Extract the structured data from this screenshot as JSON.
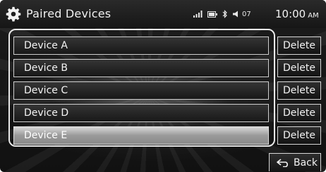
{
  "header": {
    "title": "Paired Devices",
    "volume_level": "07",
    "time": "10:00",
    "ampm": "AM",
    "icons": [
      "settings-gear-icon",
      "signal-strength-icon",
      "battery-icon",
      "bluetooth-icon",
      "speaker-volume-icon"
    ]
  },
  "devices": [
    {
      "label": "Device A",
      "selected": false
    },
    {
      "label": "Device B",
      "selected": false
    },
    {
      "label": "Device C",
      "selected": false
    },
    {
      "label": "Device D",
      "selected": false
    },
    {
      "label": "Device E",
      "selected": true
    }
  ],
  "delete_label": "Delete",
  "back_label": "Back"
}
